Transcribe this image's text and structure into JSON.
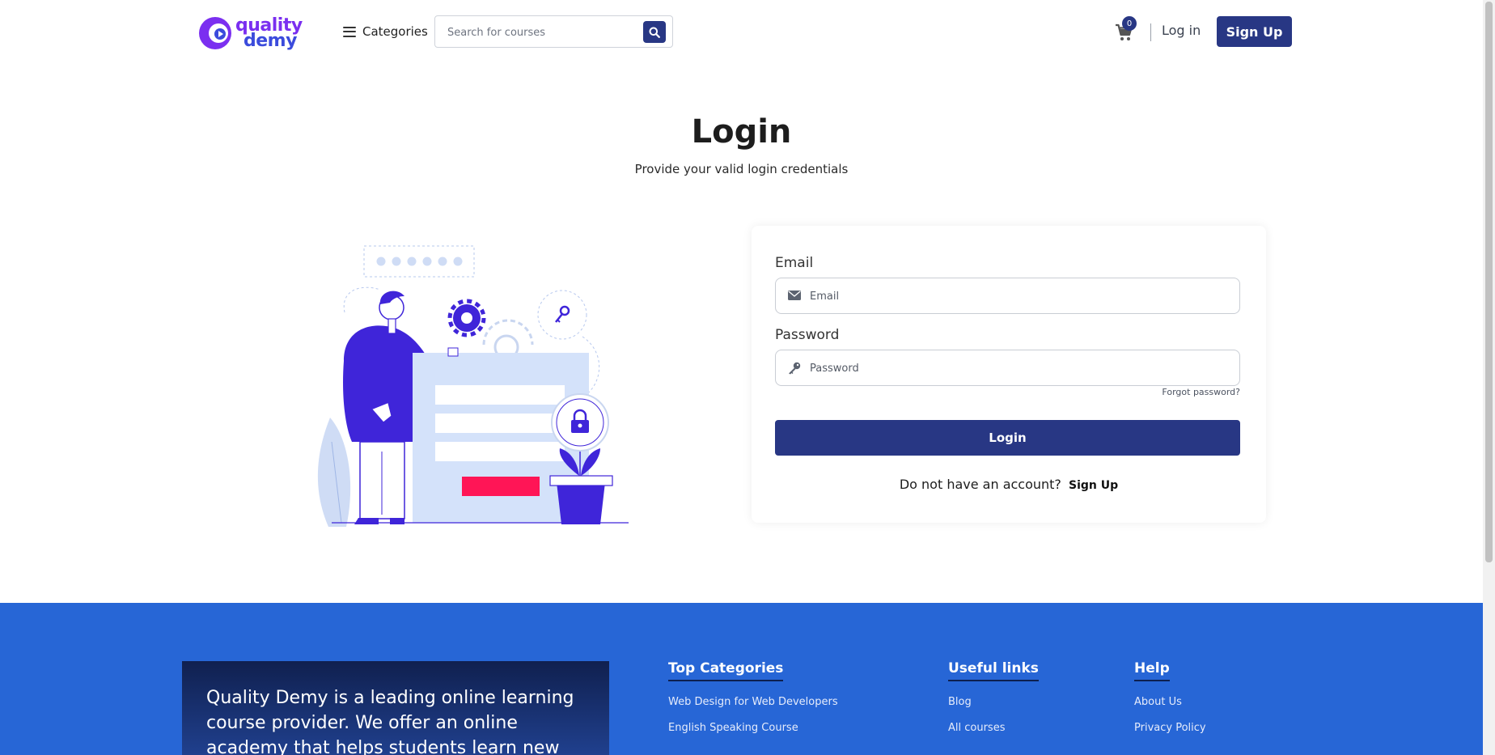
{
  "header": {
    "logo": {
      "line1": "quality",
      "line2": "demy"
    },
    "categories_label": "Categories",
    "search": {
      "placeholder": "Search for courses"
    },
    "cart_count": "0",
    "login_label": "Log in",
    "signup_label": "Sign Up"
  },
  "main": {
    "title": "Login",
    "subtitle": "Provide your valid login credentials"
  },
  "login_form": {
    "email_label": "Email",
    "email_placeholder": "Email",
    "password_label": "Password",
    "password_placeholder": "Password",
    "forgot_label": "Forgot password?",
    "submit_label": "Login",
    "no_account_text": "Do not have an account?",
    "signup_link": "Sign Up"
  },
  "footer": {
    "about": "Quality Demy is a leading online learning course provider. We offer an online academy that helps students learn new",
    "columns": [
      {
        "title": "Top Categories",
        "links": [
          "Web Design for Web Developers",
          "English Speaking Course"
        ]
      },
      {
        "title": "Useful links",
        "links": [
          "Blog",
          "All courses"
        ]
      },
      {
        "title": "Help",
        "links": [
          "About Us",
          "Privacy Policy"
        ]
      }
    ]
  },
  "colors": {
    "brand": "#283784",
    "footer_bg": "#2766d6",
    "illustration_accent": "#3f25d9",
    "illustration_button": "#ff1556"
  }
}
